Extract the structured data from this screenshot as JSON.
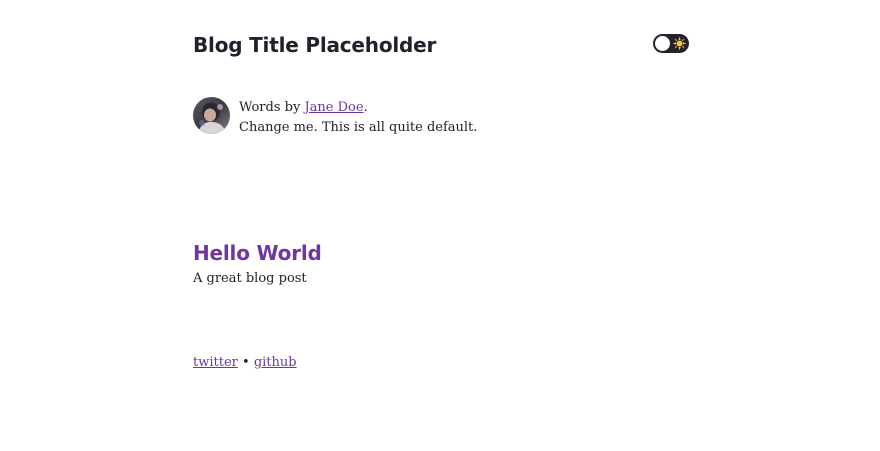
{
  "header": {
    "title": "Blog Title Placeholder",
    "theme_toggle": {
      "icon": "sun-icon",
      "state": "light"
    }
  },
  "bio": {
    "avatar_icon": "avatar",
    "prefix": "Words by ",
    "author_name": "Jane Doe",
    "suffix": ".",
    "tagline": "Change me. This is all quite default."
  },
  "posts": [
    {
      "title": "Hello World",
      "description": "A great blog post"
    }
  ],
  "footer": {
    "links": [
      {
        "label": "twitter"
      },
      {
        "label": "github"
      }
    ],
    "separator": "•"
  },
  "colors": {
    "accent": "#6f35a3",
    "text": "#22202a",
    "background": "#ffffff",
    "toggle": "#24212c"
  }
}
